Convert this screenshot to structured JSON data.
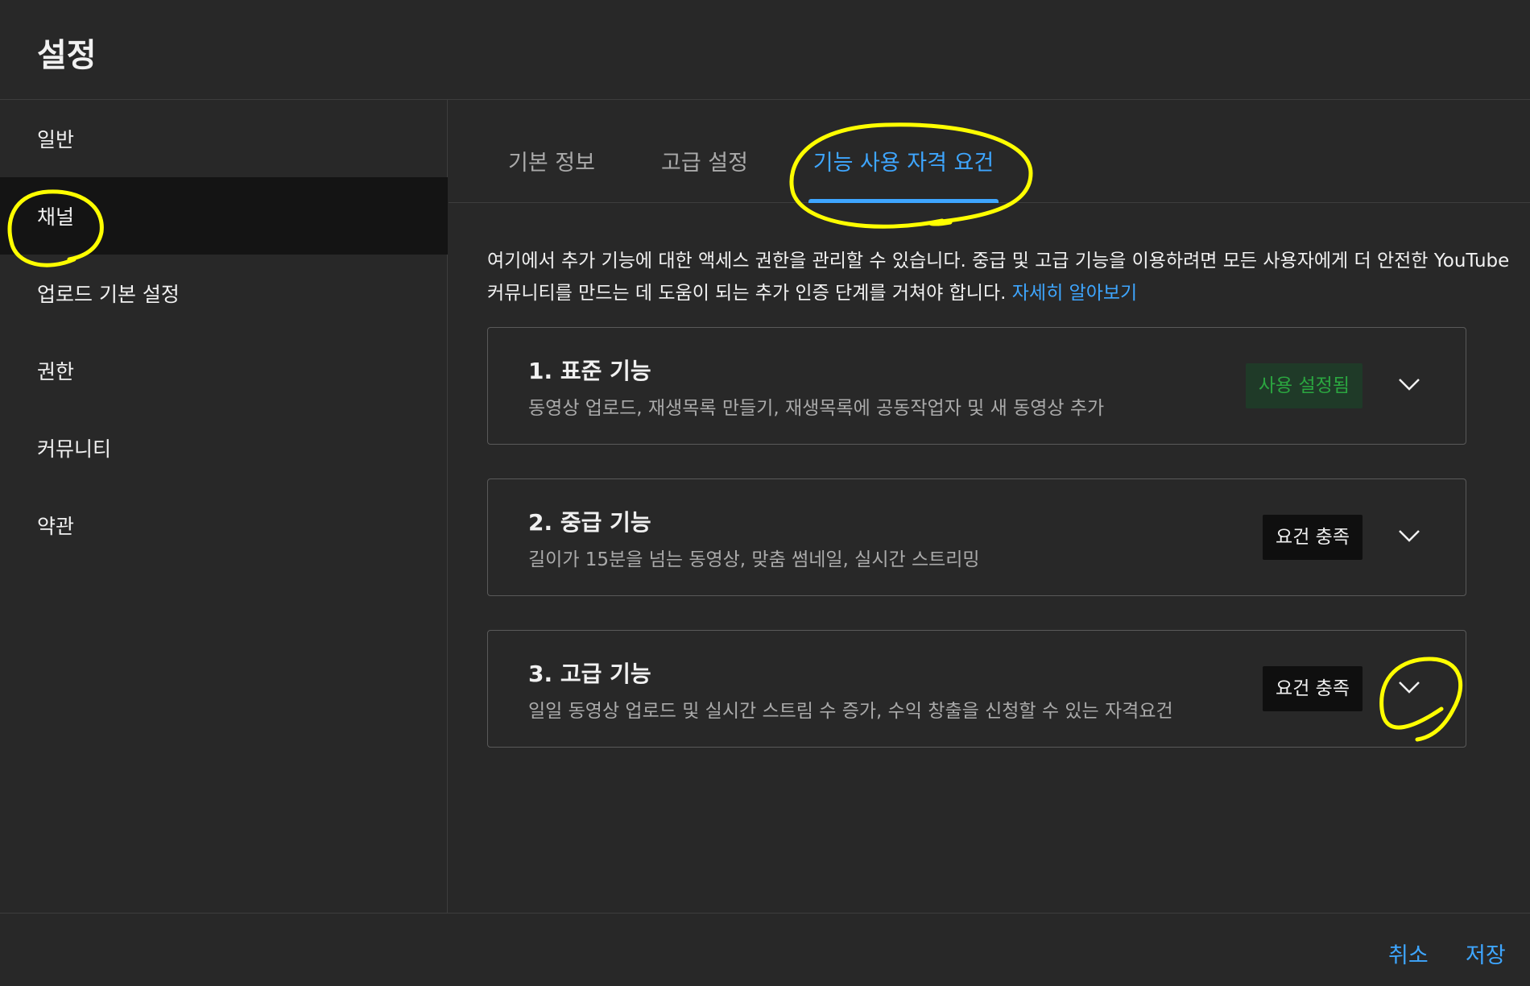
{
  "header": {
    "title": "설정"
  },
  "sidebar": {
    "items": [
      {
        "label": "일반"
      },
      {
        "label": "채널"
      },
      {
        "label": "업로드 기본 설정"
      },
      {
        "label": "권한"
      },
      {
        "label": "커뮤니티"
      },
      {
        "label": "약관"
      }
    ],
    "active_index": 1
  },
  "tabs": [
    {
      "label": "기본 정보"
    },
    {
      "label": "고급 설정"
    },
    {
      "label": "기능 사용 자격 요건"
    }
  ],
  "active_tab_index": 2,
  "description": {
    "text": "여기에서 추가 기능에 대한 액세스 권한을 관리할 수 있습니다. 중급 및 고급 기능을 이용하려면 모든 사용자에게 더 안전한 YouTube 커뮤니티를 만드는 데 도움이 되는 추가 인증 단계를 거쳐야 합니다.",
    "link": "자세히 알아보기"
  },
  "features": [
    {
      "title": "1. 표준 기능",
      "description": "동영상 업로드, 재생목록 만들기, 재생목록에 공동작업자 및 새 동영상 추가",
      "status": "사용 설정됨",
      "status_type": "enabled",
      "icon": "chevron-down-icon"
    },
    {
      "title": "2. 중급 기능",
      "description": "길이가 15분을 넘는 동영상, 맞춤 썸네일, 실시간 스트리밍",
      "status": "요건 충족",
      "status_type": "eligible",
      "icon": "chevron-down-icon"
    },
    {
      "title": "3. 고급 기능",
      "description": "일일 동영상 업로드 및 실시간 스트림 수 증가, 수익 창출을 신청할 수 있는 자격요건",
      "status": "요건 충족",
      "status_type": "eligible",
      "icon": "chevron-down-icon"
    }
  ],
  "footer": {
    "cancel": "취소",
    "save": "저장"
  },
  "colors": {
    "background": "#282828",
    "accent": "#3ea6ff",
    "enabled_text": "#2ba640",
    "annotation": "#ffff00"
  }
}
